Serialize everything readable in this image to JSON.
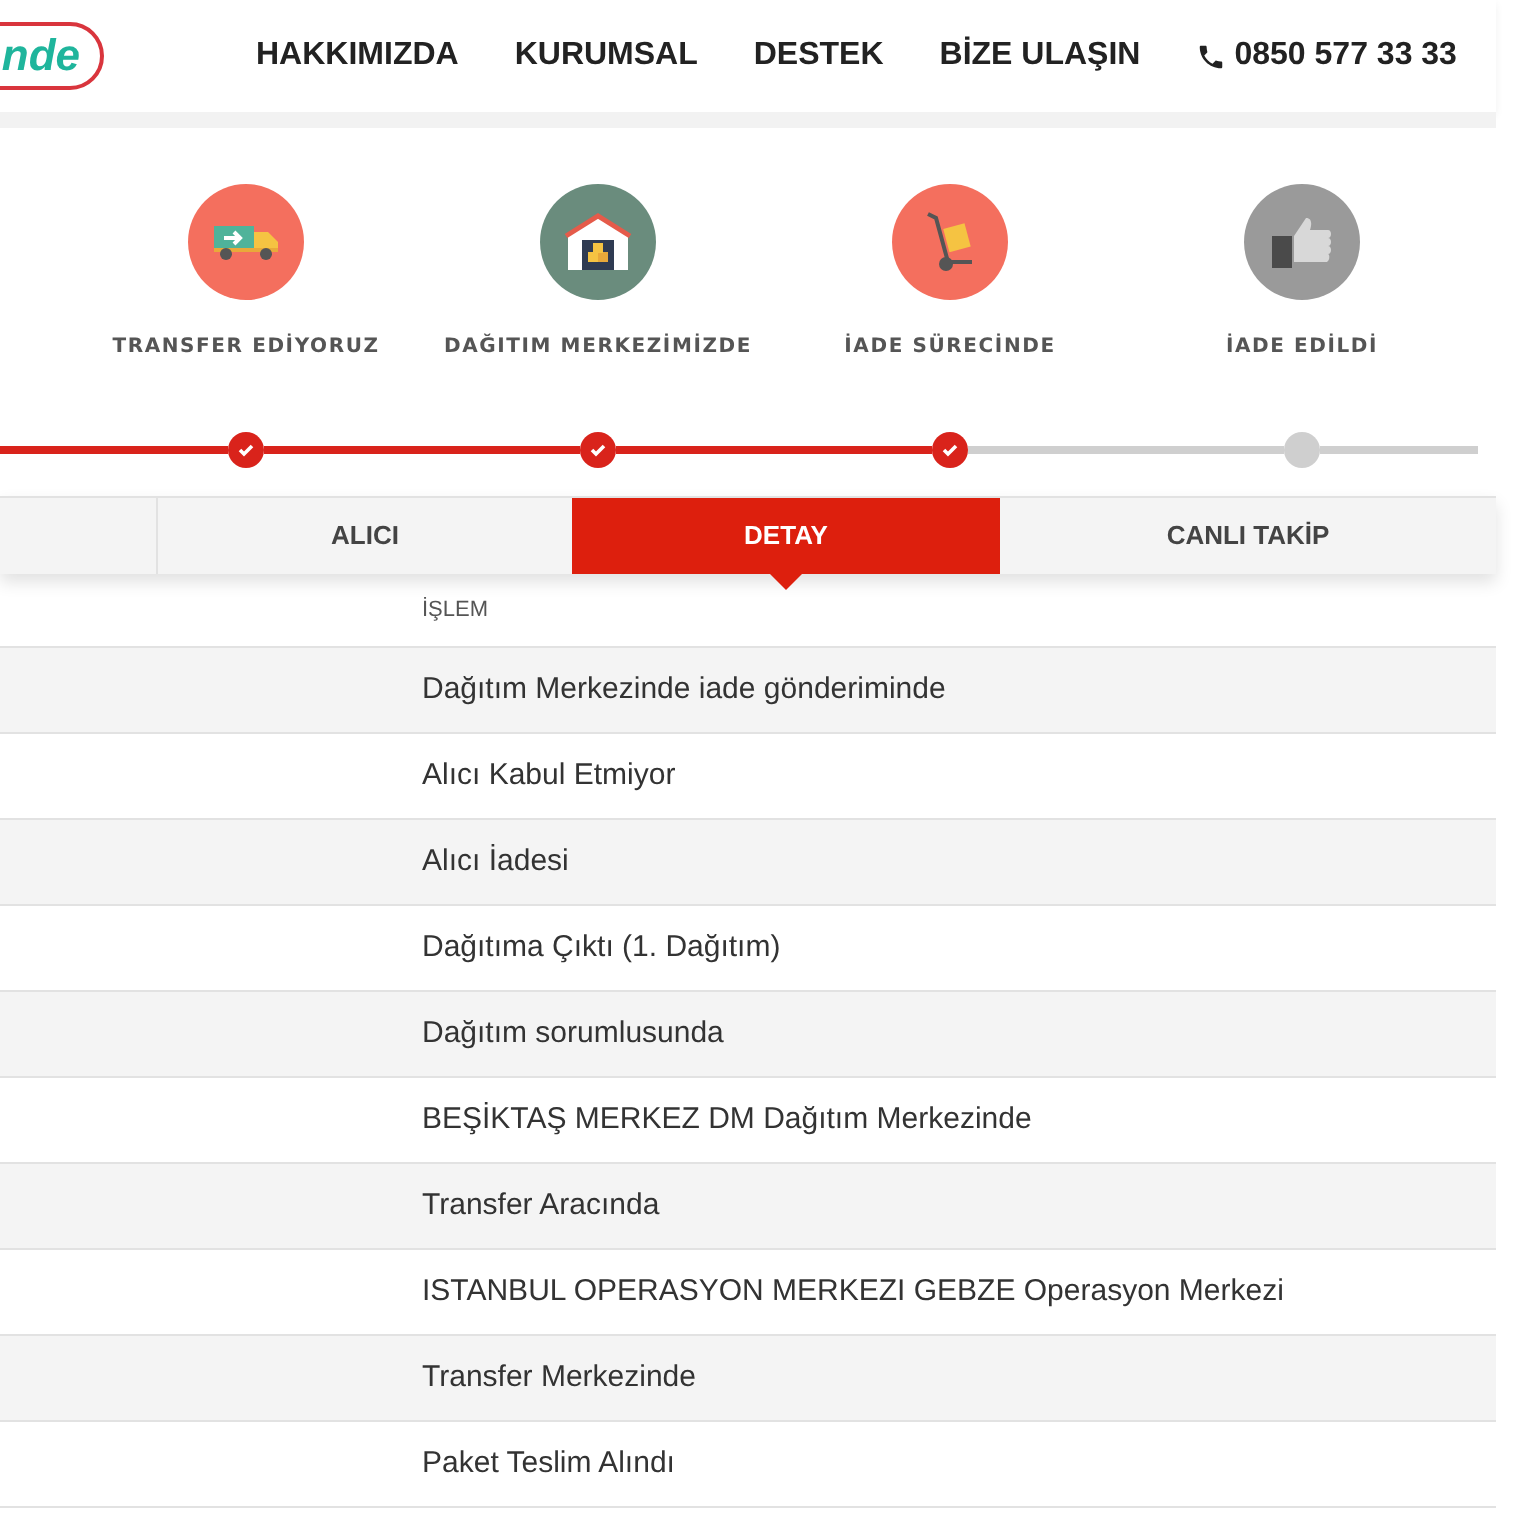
{
  "header": {
    "logo_text": "nde",
    "nav": [
      "HAKKIMIZDA",
      "KURUMSAL",
      "DESTEK",
      "BİZE ULAŞIN"
    ],
    "phone": "0850 577 33 33"
  },
  "steps": [
    {
      "label": "TRANSFER EDİYORUZ",
      "kind": "truck",
      "color": "#f46f5e",
      "done": true
    },
    {
      "label": "DAĞITIM MERKEZİMİZDE",
      "kind": "warehouse",
      "color": "#6a8c7d",
      "done": true
    },
    {
      "label": "İADE SÜRECİNDE",
      "kind": "dolly",
      "color": "#f46f5e",
      "done": true
    },
    {
      "label": "İADE EDİLDİ",
      "kind": "thumb",
      "color": "#9a9a9a",
      "done": false
    }
  ],
  "tabs": [
    {
      "label": "ALICI",
      "selected": false
    },
    {
      "label": "DETAY",
      "selected": true
    },
    {
      "label": "CANLI TAKİP",
      "selected": false
    }
  ],
  "table": {
    "columns": [
      "İŞLEM"
    ],
    "rows": [
      "Dağıtım Merkezinde iade gönderiminde",
      "Alıcı Kabul Etmiyor",
      "Alıcı İadesi",
      "Dağıtıma Çıktı (1. Dağıtım)",
      "Dağıtım sorumlusunda",
      "BEŞİKTAŞ MERKEZ DM Dağıtım Merkezinde",
      "Transfer Aracında",
      "ISTANBUL OPERASYON MERKEZI GEBZE Operasyon Merkezi",
      "Transfer Merkezinde",
      "Paket Teslim Alındı"
    ]
  }
}
